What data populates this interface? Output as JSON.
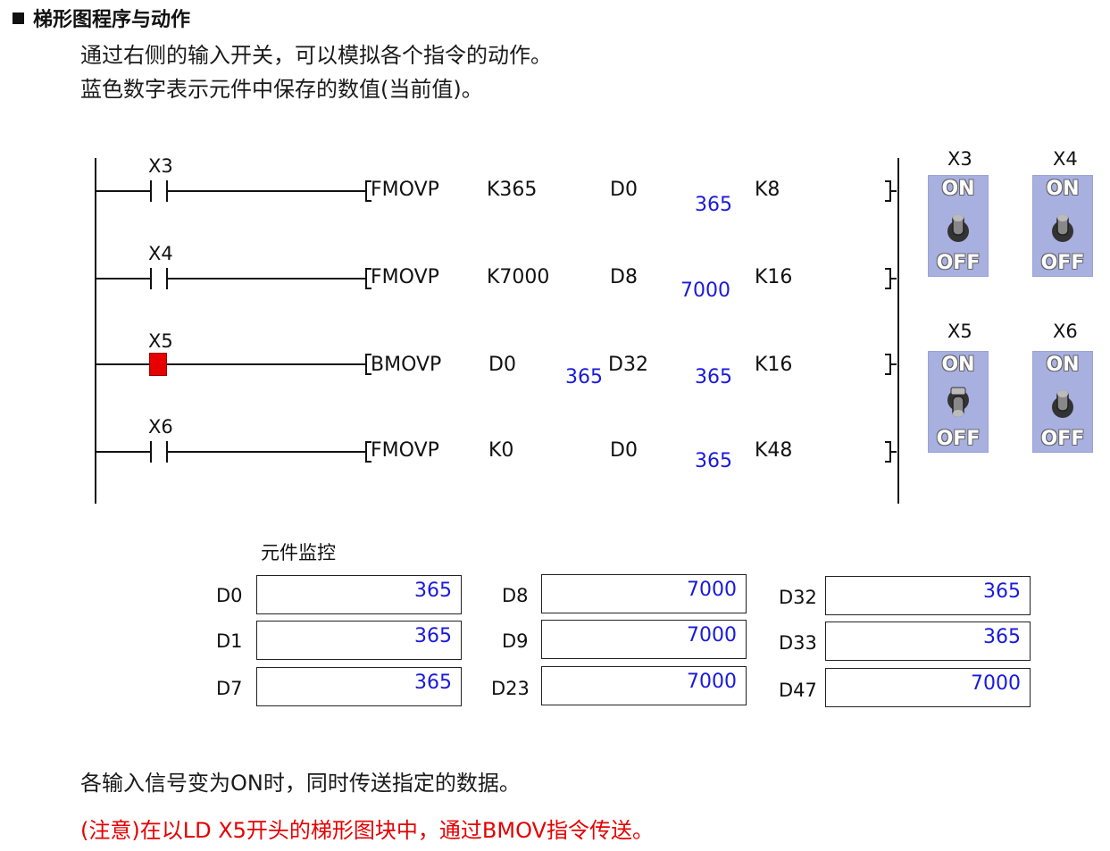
{
  "header": {
    "title": "梯形图程序与动作",
    "line1": "通过右侧的输入开关，可以模拟各个指令的动作。",
    "line2": "蓝色数字表示元件中保存的数值(当前值)。"
  },
  "ladder": {
    "rungs": [
      {
        "contact": "X3",
        "state": "off",
        "instr": "FMOVP",
        "op1": "K365",
        "op1_val": "",
        "op2": "D0",
        "op2_val": "365",
        "op3": "K8"
      },
      {
        "contact": "X4",
        "state": "off",
        "instr": "FMOVP",
        "op1": "K7000",
        "op1_val": "",
        "op2": "D8",
        "op2_val": "7000",
        "op3": "K16"
      },
      {
        "contact": "X5",
        "state": "on",
        "instr": "BMOVP",
        "op1": "D0",
        "op1_val": "365",
        "op2": "D32",
        "op2_val": "365",
        "op3": "K16"
      },
      {
        "contact": "X6",
        "state": "off",
        "instr": "FMOVP",
        "op1": "K0",
        "op1_val": "",
        "op2": "D0",
        "op2_val": "365",
        "op3": "K48"
      }
    ]
  },
  "switches": [
    {
      "label": "X3",
      "on_text": "ON",
      "off_text": "OFF",
      "position": "up"
    },
    {
      "label": "X4",
      "on_text": "ON",
      "off_text": "OFF",
      "position": "up"
    },
    {
      "label": "X5",
      "on_text": "ON",
      "off_text": "OFF",
      "position": "down"
    },
    {
      "label": "X6",
      "on_text": "ON",
      "off_text": "OFF",
      "position": "up"
    }
  ],
  "monitor": {
    "title": "元件监控",
    "columns": [
      [
        {
          "name": "D0",
          "value": "365"
        },
        {
          "name": "D1",
          "value": "365"
        },
        {
          "name": "D7",
          "value": "365"
        }
      ],
      [
        {
          "name": "D8",
          "value": "7000"
        },
        {
          "name": "D9",
          "value": "7000"
        },
        {
          "name": "D23",
          "value": "7000"
        }
      ],
      [
        {
          "name": "D32",
          "value": "365"
        },
        {
          "name": "D33",
          "value": "365"
        },
        {
          "name": "D47",
          "value": "7000"
        }
      ]
    ]
  },
  "notes": {
    "line1": "各输入信号变为ON时，同时传送指定的数据。",
    "line2": "(注意)在以LD X5开头的梯形图块中，通过BMOV指令传送。"
  },
  "colors": {
    "value_blue": "#1a1adc",
    "contact_on": "#e60000",
    "switch_bg": "#a8b0e0",
    "note_red": "#e60000"
  }
}
